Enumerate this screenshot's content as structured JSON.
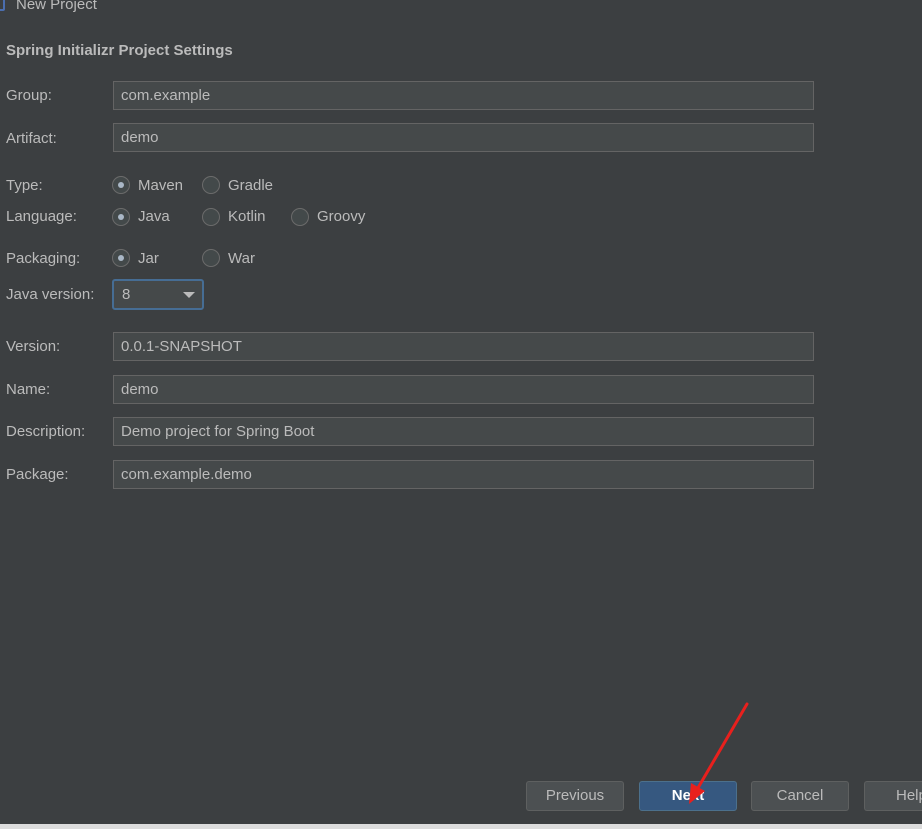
{
  "window": {
    "title": "New Project"
  },
  "section_title": "Spring Initializr Project Settings",
  "fields": {
    "group": {
      "label": "Group:",
      "value": "com.example"
    },
    "artifact": {
      "label": "Artifact:",
      "value": "demo"
    },
    "version": {
      "label": "Version:",
      "value": "0.0.1-SNAPSHOT"
    },
    "name": {
      "label": "Name:",
      "value": "demo"
    },
    "description": {
      "label": "Description:",
      "value": "Demo project for Spring Boot"
    },
    "package": {
      "label": "Package:",
      "value": "com.example.demo"
    }
  },
  "type": {
    "label": "Type:",
    "options": [
      "Maven",
      "Gradle"
    ],
    "selected": "Maven"
  },
  "language": {
    "label": "Language:",
    "options": [
      "Java",
      "Kotlin",
      "Groovy"
    ],
    "selected": "Java"
  },
  "packaging": {
    "label": "Packaging:",
    "options": [
      "Jar",
      "War"
    ],
    "selected": "Jar"
  },
  "java_version": {
    "label": "Java version:",
    "value": "8"
  },
  "buttons": {
    "previous": "Previous",
    "next": "Next",
    "cancel": "Cancel",
    "help": "Help"
  },
  "colors": {
    "background": "#3c3f41",
    "field_background": "#45494a",
    "primary_button": "#365880",
    "annotation_arrow": "#e8201d"
  },
  "icons": {
    "window_icon": "project-icon",
    "dropdown": "chevron-down-icon",
    "annotation": "red-arrow-annotation"
  }
}
